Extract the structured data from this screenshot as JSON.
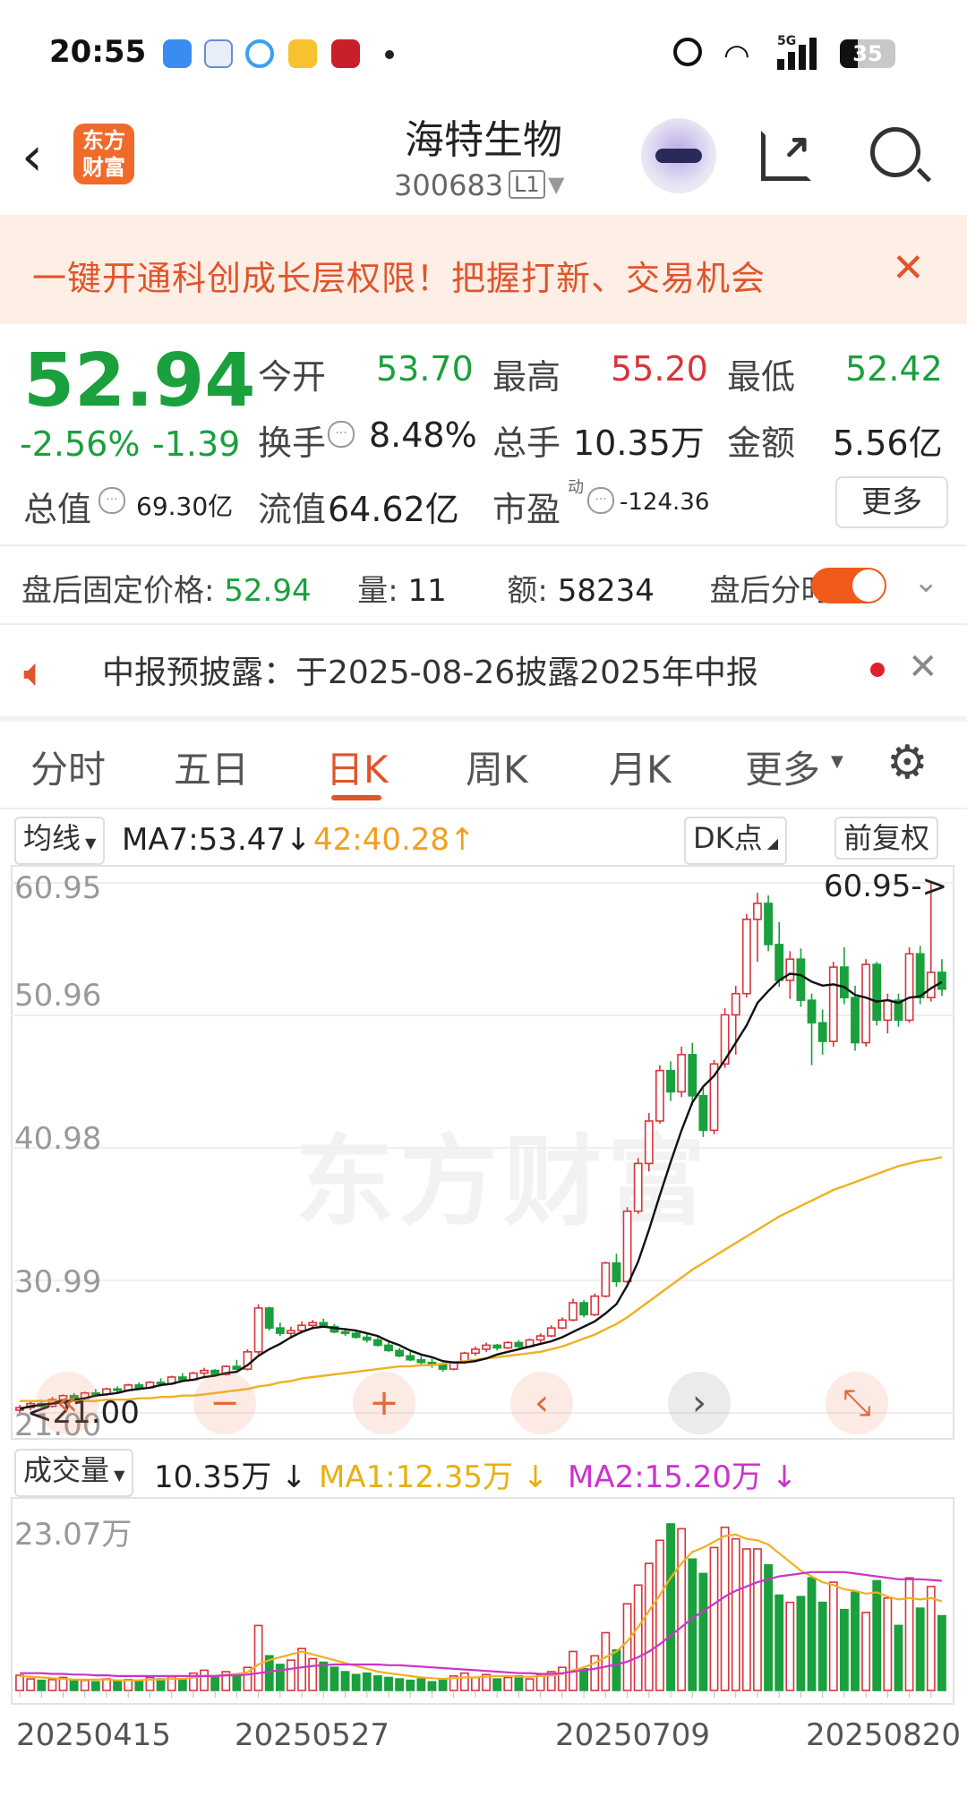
{
  "status_bar": {
    "time": "20:55",
    "battery": "35",
    "network": "5G"
  },
  "header": {
    "title": "海特生物",
    "code": "300683",
    "level": "L1"
  },
  "banner": {
    "text": "一键开通科创成长层权限！把握打新、交易机会"
  },
  "quote": {
    "price": "52.94",
    "change_pct": "-2.56%",
    "change": "-1.39",
    "open_label": "今开",
    "open": "53.70",
    "high_label": "最高",
    "high": "55.20",
    "low_label": "最低",
    "low": "52.42",
    "turnover_label": "换手",
    "turnover": "8.48%",
    "volume_label": "总手",
    "volume": "10.35万",
    "amount_label": "金额",
    "amount": "5.56亿",
    "mktcap_label": "总值",
    "mktcap": "69.30亿",
    "float_label": "流值",
    "float": "64.62亿",
    "pe_label": "市盈",
    "pe_sup": "动",
    "pe": "-124.36",
    "more": "更多"
  },
  "after_hours": {
    "price_label": "盘后固定价格:",
    "price": "52.94",
    "qty_label": "量:",
    "qty": "11",
    "amount_label": "额:",
    "amount": "58234",
    "toggle_label": "盘后分时"
  },
  "notice": {
    "text": "中报预披露：于2025-08-26披露2025年中报"
  },
  "tabs": [
    "分时",
    "五日",
    "日K",
    "周K",
    "月K",
    "更多"
  ],
  "kline_toolbar": {
    "ma_select": "均线",
    "ma7": "MA7:53.47",
    "ma_arrow": "↓",
    "ma42": "42:40.28",
    "ma42_arrow": "↑",
    "dk": "DK点",
    "adjust": "前复权"
  },
  "kline": {
    "y_ticks": [
      "60.95",
      "50.96",
      "40.98",
      "30.99",
      "21.00"
    ],
    "max_label": "60.95->",
    "min_label": "<21.00"
  },
  "volume_toolbar": {
    "select": "成交量",
    "value": "10.35万",
    "value_arrow": "↓",
    "ma1": "MA1:12.35万",
    "ma1_arrow": "↓",
    "ma2": "MA2:15.20万",
    "ma2_arrow": "↓",
    "top_label": "23.07万"
  },
  "x_labels": [
    "20250415",
    "20250527",
    "20250709",
    "20250820"
  ],
  "colors": {
    "up": "#d8343a",
    "down": "#1aa03c",
    "ma_short": "#111111",
    "ma_long": "#f0b020",
    "vol_ma1": "#f0b020",
    "vol_ma2": "#cc33cc",
    "accent": "#e0552a"
  },
  "chart_data": {
    "type": "candlestick",
    "ylim": [
      21.0,
      60.95
    ],
    "candles": [
      [
        21.2,
        21.6,
        21.0,
        21.4
      ],
      [
        21.4,
        21.9,
        21.2,
        21.7
      ],
      [
        21.7,
        22.0,
        21.4,
        21.5
      ],
      [
        21.5,
        22.2,
        21.4,
        22.0
      ],
      [
        22.0,
        22.4,
        21.8,
        22.3
      ],
      [
        22.3,
        22.5,
        21.9,
        22.1
      ],
      [
        22.1,
        22.6,
        22.0,
        22.5
      ],
      [
        22.5,
        22.8,
        22.2,
        22.4
      ],
      [
        22.4,
        22.9,
        22.3,
        22.8
      ],
      [
        22.8,
        23.0,
        22.5,
        22.7
      ],
      [
        22.7,
        23.2,
        22.6,
        23.1
      ],
      [
        23.1,
        23.3,
        22.8,
        22.9
      ],
      [
        22.9,
        23.4,
        22.8,
        23.3
      ],
      [
        23.3,
        23.6,
        23.0,
        23.2
      ],
      [
        23.2,
        23.8,
        23.1,
        23.7
      ],
      [
        23.7,
        24.0,
        23.4,
        23.5
      ],
      [
        23.5,
        24.1,
        23.4,
        24.0
      ],
      [
        24.0,
        24.4,
        23.8,
        24.2
      ],
      [
        24.2,
        24.3,
        23.8,
        23.9
      ],
      [
        23.9,
        24.6,
        23.8,
        24.5
      ],
      [
        24.5,
        25.0,
        24.2,
        24.3
      ],
      [
        24.3,
        25.8,
        24.2,
        25.6
      ],
      [
        25.6,
        29.2,
        25.4,
        28.9
      ],
      [
        28.9,
        29.0,
        27.2,
        27.4
      ],
      [
        27.4,
        27.8,
        26.8,
        27.0
      ],
      [
        27.0,
        27.5,
        26.6,
        27.2
      ],
      [
        27.2,
        27.9,
        27.0,
        27.6
      ],
      [
        27.6,
        28.0,
        27.3,
        27.8
      ],
      [
        27.8,
        28.1,
        27.4,
        27.5
      ],
      [
        27.5,
        27.7,
        27.0,
        27.1
      ],
      [
        27.1,
        27.4,
        26.8,
        27.0
      ],
      [
        27.0,
        27.2,
        26.6,
        26.7
      ],
      [
        26.7,
        27.0,
        26.3,
        26.5
      ],
      [
        26.5,
        26.7,
        26.0,
        26.1
      ],
      [
        26.1,
        26.3,
        25.6,
        25.7
      ],
      [
        25.7,
        25.9,
        25.2,
        25.3
      ],
      [
        25.3,
        25.6,
        24.9,
        25.0
      ],
      [
        25.0,
        25.3,
        24.6,
        24.8
      ],
      [
        24.8,
        25.1,
        24.4,
        24.6
      ],
      [
        24.6,
        24.8,
        24.1,
        24.3
      ],
      [
        24.3,
        24.9,
        24.2,
        24.8
      ],
      [
        24.8,
        25.6,
        24.7,
        25.5
      ],
      [
        25.5,
        26.0,
        25.3,
        25.8
      ],
      [
        25.8,
        26.3,
        25.6,
        26.1
      ],
      [
        26.1,
        26.2,
        25.7,
        25.9
      ],
      [
        25.9,
        26.4,
        25.8,
        26.3
      ],
      [
        26.3,
        26.5,
        25.9,
        26.0
      ],
      [
        26.0,
        26.6,
        25.9,
        26.5
      ],
      [
        26.5,
        27.0,
        26.3,
        26.8
      ],
      [
        26.8,
        27.6,
        26.7,
        27.4
      ],
      [
        27.4,
        28.2,
        27.3,
        28.0
      ],
      [
        28.0,
        29.6,
        27.9,
        29.3
      ],
      [
        29.3,
        29.5,
        28.2,
        28.4
      ],
      [
        28.4,
        30.0,
        28.3,
        29.8
      ],
      [
        29.8,
        32.4,
        29.7,
        32.3
      ],
      [
        32.3,
        33.0,
        30.5,
        30.9
      ],
      [
        30.9,
        36.5,
        30.8,
        36.2
      ],
      [
        36.2,
        40.2,
        36.0,
        39.8
      ],
      [
        39.8,
        43.6,
        39.2,
        43.0
      ],
      [
        43.0,
        47.2,
        42.8,
        46.8
      ],
      [
        46.8,
        47.5,
        44.5,
        45.2
      ],
      [
        45.2,
        48.6,
        44.8,
        48.0
      ],
      [
        48.0,
        48.9,
        44.2,
        44.9
      ],
      [
        44.9,
        45.5,
        41.8,
        42.3
      ],
      [
        42.3,
        47.6,
        42.0,
        47.3
      ],
      [
        47.3,
        51.5,
        47.0,
        51.0
      ],
      [
        51.0,
        53.2,
        48.0,
        52.6
      ],
      [
        52.6,
        58.6,
        52.3,
        58.2
      ],
      [
        58.2,
        60.2,
        55.0,
        59.4
      ],
      [
        59.4,
        60.0,
        55.8,
        56.3
      ],
      [
        56.3,
        58.0,
        53.1,
        53.6
      ],
      [
        53.6,
        55.8,
        52.2,
        55.2
      ],
      [
        55.2,
        56.0,
        51.6,
        52.1
      ],
      [
        52.1,
        52.6,
        47.2,
        50.4
      ],
      [
        50.4,
        51.4,
        48.0,
        49.0
      ],
      [
        49.0,
        55.0,
        48.6,
        54.6
      ],
      [
        54.6,
        56.1,
        51.8,
        52.3
      ],
      [
        52.3,
        53.2,
        48.3,
        48.9
      ],
      [
        48.9,
        55.2,
        48.6,
        54.8
      ],
      [
        54.8,
        55.0,
        50.2,
        50.6
      ],
      [
        50.6,
        52.6,
        49.6,
        52.1
      ],
      [
        52.1,
        52.6,
        50.1,
        50.6
      ],
      [
        50.6,
        56.1,
        50.4,
        55.6
      ],
      [
        55.6,
        56.2,
        51.8,
        52.3
      ],
      [
        52.3,
        60.95,
        52.0,
        54.2
      ],
      [
        54.2,
        55.2,
        52.42,
        52.94
      ]
    ],
    "ma_short": [
      21.3,
      21.5,
      21.6,
      21.7,
      21.8,
      22.0,
      22.1,
      22.3,
      22.4,
      22.5,
      22.7,
      22.8,
      22.9,
      23.1,
      23.2,
      23.4,
      23.5,
      23.7,
      23.8,
      24.0,
      24.1,
      24.6,
      25.3,
      25.8,
      26.2,
      26.7,
      27.1,
      27.4,
      27.5,
      27.4,
      27.3,
      27.2,
      27.0,
      26.8,
      26.4,
      26.1,
      25.7,
      25.4,
      25.2,
      24.9,
      24.8,
      24.8,
      24.9,
      25.1,
      25.4,
      25.6,
      25.8,
      26.0,
      26.2,
      26.4,
      26.7,
      27.1,
      27.5,
      27.9,
      28.5,
      29.2,
      30.6,
      32.4,
      34.8,
      37.4,
      39.9,
      42.3,
      44.4,
      45.6,
      46.4,
      47.6,
      48.9,
      50.2,
      51.9,
      52.8,
      53.6,
      54.1,
      54.0,
      53.5,
      53.2,
      53.3,
      53.1,
      52.5,
      52.3,
      52.0,
      52.1,
      51.9,
      52.3,
      52.4,
      53.0,
      53.47
    ],
    "ma_long": [
      21.9,
      21.9,
      21.9,
      21.9,
      21.9,
      21.9,
      21.9,
      21.9,
      22.0,
      22.0,
      22.0,
      22.1,
      22.1,
      22.2,
      22.2,
      22.3,
      22.3,
      22.4,
      22.5,
      22.6,
      22.7,
      22.8,
      23.0,
      23.1,
      23.3,
      23.4,
      23.6,
      23.7,
      23.8,
      23.9,
      24.0,
      24.1,
      24.2,
      24.3,
      24.4,
      24.5,
      24.5,
      24.6,
      24.6,
      24.7,
      24.8,
      24.9,
      25.0,
      25.1,
      25.2,
      25.3,
      25.4,
      25.5,
      25.6,
      25.8,
      26.0,
      26.3,
      26.6,
      26.9,
      27.3,
      27.7,
      28.2,
      28.8,
      29.4,
      30.0,
      30.6,
      31.2,
      31.8,
      32.3,
      32.8,
      33.3,
      33.8,
      34.3,
      34.8,
      35.3,
      35.8,
      36.2,
      36.6,
      37.0,
      37.4,
      37.8,
      38.1,
      38.4,
      38.7,
      39.0,
      39.3,
      39.6,
      39.8,
      40.0,
      40.1,
      40.28
    ],
    "volume": [
      2.1,
      1.6,
      1.4,
      1.5,
      1.8,
      1.3,
      1.4,
      1.2,
      1.6,
      1.3,
      1.5,
      1.4,
      1.8,
      1.6,
      1.9,
      1.5,
      2.4,
      2.8,
      1.8,
      2.6,
      2.0,
      3.2,
      9.0,
      4.8,
      3.6,
      4.2,
      5.8,
      4.4,
      3.9,
      3.2,
      2.6,
      2.2,
      2.4,
      2.0,
      1.8,
      1.6,
      1.4,
      1.6,
      1.2,
      1.4,
      2.0,
      2.4,
      1.8,
      2.2,
      1.6,
      1.8,
      2.0,
      1.6,
      2.2,
      2.6,
      3.2,
      5.4,
      3.0,
      4.8,
      8.0,
      5.6,
      12.0,
      14.6,
      17.6,
      20.8,
      23.07,
      22.4,
      18.2,
      16.2,
      19.8,
      22.6,
      21.0,
      19.6,
      19.6,
      17.4,
      13.2,
      12.2,
      13.0,
      15.6,
      12.2,
      15.0,
      11.2,
      13.6,
      10.8,
      15.2,
      12.8,
      9.0,
      15.6,
      11.4,
      14.4,
      10.35
    ],
    "vol_ma1": [
      2.0,
      1.9,
      1.8,
      1.7,
      1.6,
      1.5,
      1.5,
      1.5,
      1.5,
      1.4,
      1.4,
      1.4,
      1.5,
      1.5,
      1.6,
      1.6,
      1.8,
      2.0,
      2.0,
      2.2,
      2.3,
      2.5,
      3.6,
      4.2,
      4.6,
      5.0,
      5.4,
      5.0,
      4.6,
      4.2,
      3.8,
      3.4,
      3.0,
      2.6,
      2.4,
      2.2,
      2.0,
      1.8,
      1.7,
      1.6,
      1.7,
      1.8,
      1.8,
      1.9,
      2.0,
      2.0,
      1.9,
      1.9,
      2.0,
      2.1,
      2.3,
      2.8,
      3.2,
      3.8,
      4.6,
      5.4,
      6.8,
      8.8,
      11.0,
      13.2,
      15.6,
      17.6,
      19.2,
      19.8,
      20.6,
      21.4,
      21.6,
      21.0,
      20.8,
      20.2,
      19.0,
      17.8,
      16.6,
      15.8,
      15.0,
      14.6,
      14.0,
      13.8,
      13.4,
      13.6,
      13.0,
      12.6,
      12.8,
      12.6,
      12.8,
      12.35
    ],
    "vol_ma2": [
      2.4,
      2.4,
      2.4,
      2.3,
      2.3,
      2.2,
      2.2,
      2.1,
      2.1,
      2.0,
      2.0,
      2.0,
      2.0,
      2.0,
      2.0,
      2.0,
      2.0,
      2.0,
      2.0,
      2.1,
      2.1,
      2.2,
      2.4,
      2.6,
      2.8,
      3.0,
      3.2,
      3.4,
      3.5,
      3.6,
      3.6,
      3.6,
      3.6,
      3.6,
      3.5,
      3.5,
      3.4,
      3.3,
      3.2,
      3.1,
      3.0,
      2.9,
      2.8,
      2.7,
      2.6,
      2.5,
      2.4,
      2.4,
      2.3,
      2.3,
      2.4,
      2.6,
      2.8,
      3.0,
      3.3,
      3.6,
      4.0,
      4.6,
      5.4,
      6.4,
      7.6,
      8.8,
      10.0,
      11.0,
      12.0,
      13.0,
      13.8,
      14.4,
      15.0,
      15.4,
      15.8,
      16.0,
      16.2,
      16.4,
      16.4,
      16.4,
      16.4,
      16.2,
      16.0,
      15.8,
      15.6,
      15.4,
      15.4,
      15.4,
      15.3,
      15.2
    ]
  }
}
